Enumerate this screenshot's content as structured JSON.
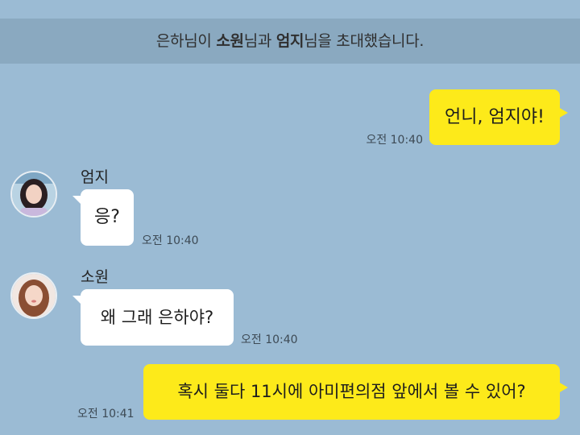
{
  "system_notice": {
    "part1": "은하님이 ",
    "name1": "소원",
    "part2": "님과 ",
    "name2": "엄지",
    "part3": "님을 초대했습니다."
  },
  "messages": [
    {
      "sender": "",
      "text": "언니, 엄지야!",
      "time": "오전 10:40",
      "side": "right"
    },
    {
      "sender": "엄지",
      "text": "응?",
      "time": "오전 10:40",
      "side": "left"
    },
    {
      "sender": "소원",
      "text": "왜 그래 은하야?",
      "time": "오전 10:40",
      "side": "left"
    },
    {
      "sender": "",
      "text": "혹시 둘다 11시에 아미편의점 앞에서 볼 수 있어?",
      "time": "오전 10:41",
      "side": "right"
    }
  ],
  "colors": {
    "background": "#9bbbd4",
    "notice_band": "#8aa9c0",
    "my_bubble": "#fdea1a",
    "other_bubble": "#ffffff"
  }
}
